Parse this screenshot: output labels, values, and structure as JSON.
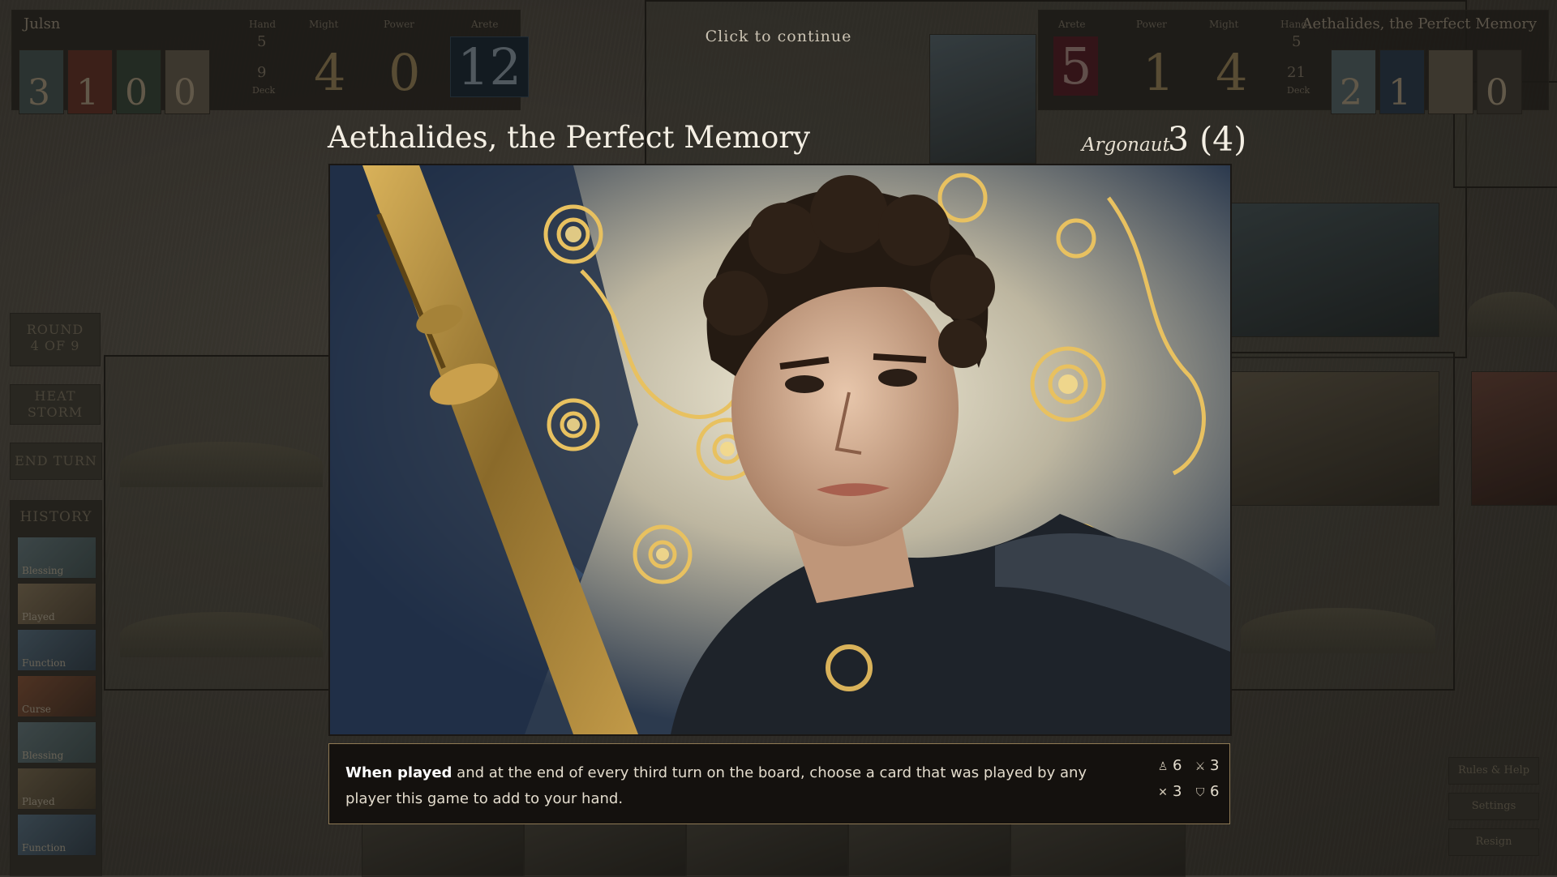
{
  "left_player": {
    "name": "Julsn",
    "headers": [
      "Hand",
      "Might",
      "Power",
      "Arete"
    ],
    "mini_values": [
      "3",
      "1",
      "0",
      "0"
    ],
    "hand_count": "5",
    "deck_count": "9",
    "deck_label": "Deck",
    "might": "4",
    "power": "0",
    "arete": "12"
  },
  "right_player": {
    "name": "Aethalides, the Perfect Memory",
    "headers": [
      "Arete",
      "Power",
      "Might",
      "Hand"
    ],
    "arete": "5",
    "power": "1",
    "might": "4",
    "hand_count": "5",
    "deck_count": "21",
    "deck_label": "Deck",
    "mini_values": [
      "2",
      "1",
      "0"
    ]
  },
  "sidebar": {
    "round_label": "ROUND",
    "round_value": "4 OF 9",
    "action_label": "HEAT STORM",
    "end_turn": "END TURN",
    "history_title": "HISTORY",
    "history": [
      "Blessing",
      "Played",
      "Function",
      "Curse",
      "Blessing",
      "Played",
      "Function"
    ]
  },
  "right_buttons": [
    "Rules & Help",
    "Settings",
    "Resign"
  ],
  "prompt": "Click to continue",
  "card": {
    "name": "Aethalides, the Perfect Memory",
    "type": "Argonaut",
    "cost": "3 (4)",
    "trigger": "When played",
    "text": " and at the end of every third turn on the board, choose a card that was played by any player this game to add to your hand.",
    "stats": [
      {
        "icon": "influence-icon",
        "glyph": "♙",
        "value": "6"
      },
      {
        "icon": "speed-icon",
        "glyph": "⚔",
        "value": "3"
      },
      {
        "icon": "might-icon",
        "glyph": "✕",
        "value": "3"
      },
      {
        "icon": "shield-icon",
        "glyph": "⛉",
        "value": "6"
      }
    ]
  },
  "colors": {
    "accent_gold": "#8f7a55",
    "arete_blue": "#13222f",
    "opponent_red": "#4a1520"
  }
}
